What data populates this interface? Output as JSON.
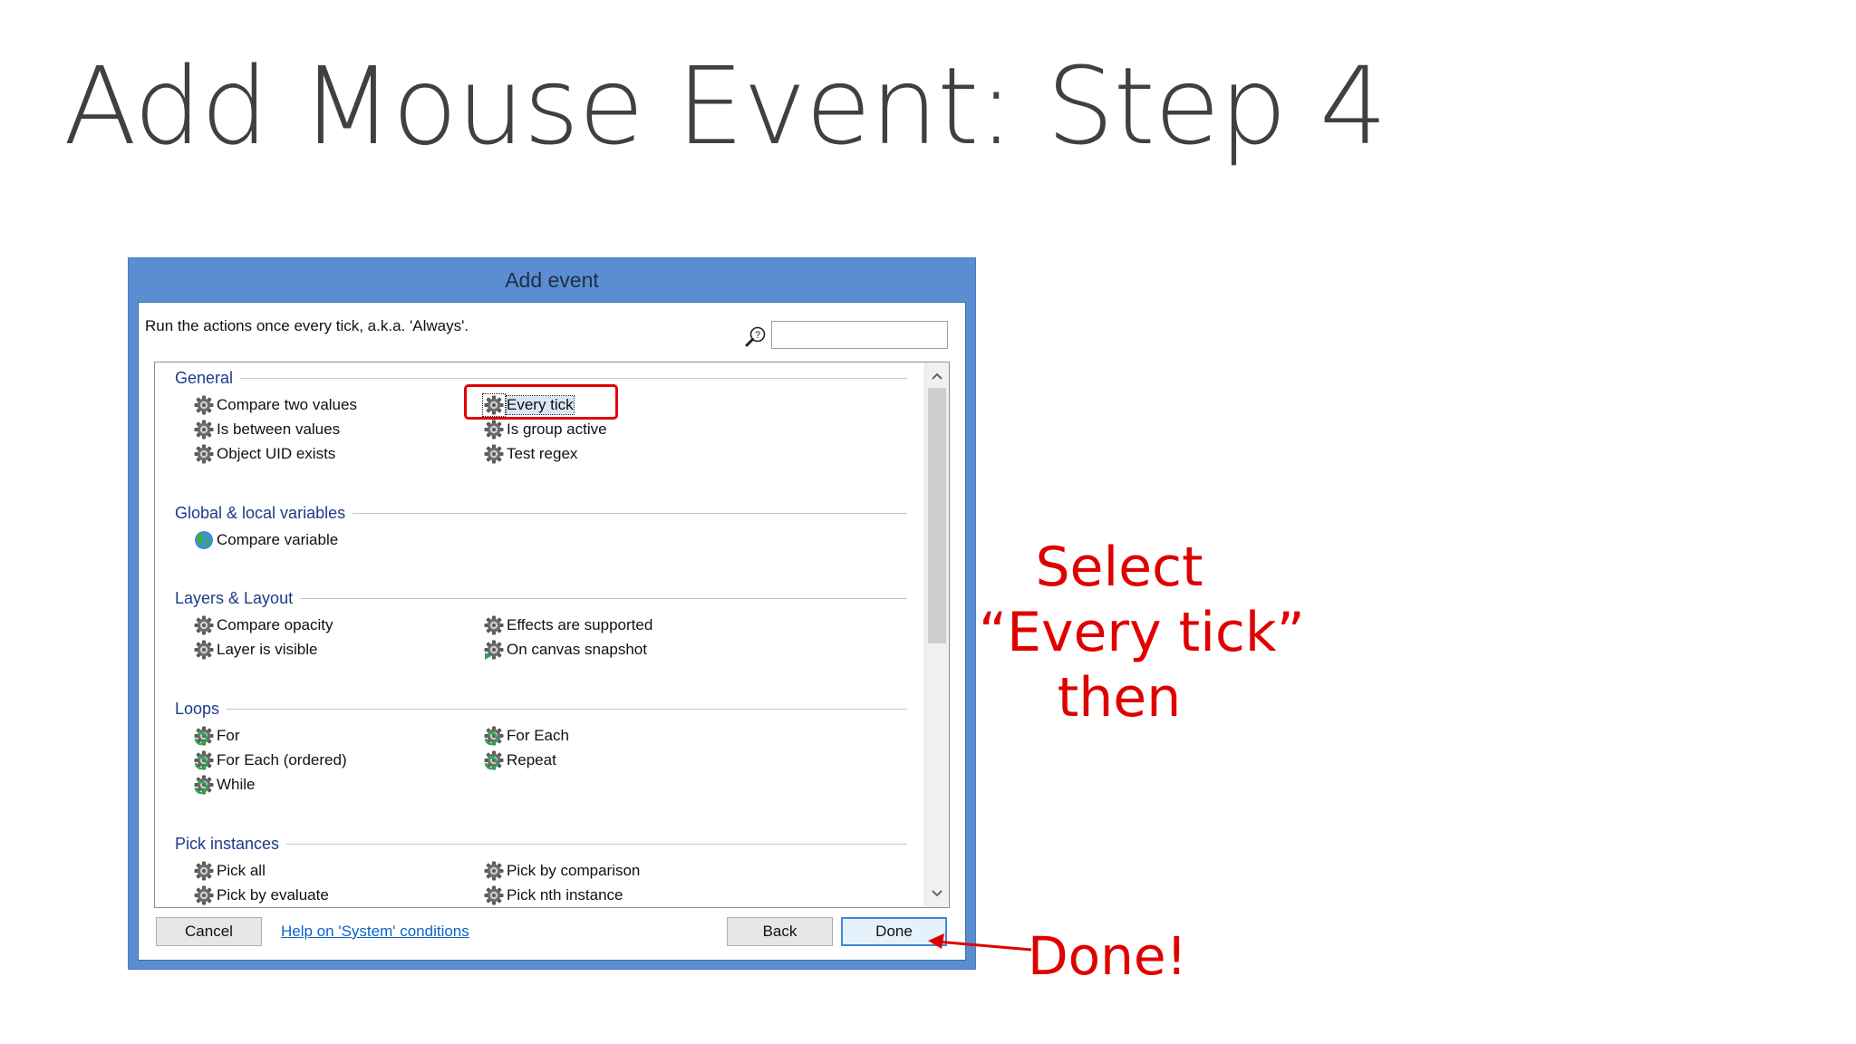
{
  "slide": {
    "title": "Add Mouse Event: Step 4"
  },
  "dialog": {
    "title": "Add event",
    "description": "Run the actions once every tick, a.k.a. 'Always'.",
    "search": {
      "value": "",
      "placeholder": ""
    },
    "groups": [
      {
        "label": "General",
        "items": [
          {
            "label": "Compare two values",
            "icon": "gear-icon"
          },
          {
            "label": "Is between values",
            "icon": "gear-icon"
          },
          {
            "label": "Object UID exists",
            "icon": "gear-icon"
          },
          {
            "label": "Every tick",
            "icon": "gear-icon",
            "selected": true
          },
          {
            "label": "Is group active",
            "icon": "gear-icon"
          },
          {
            "label": "Test regex",
            "icon": "gear-icon"
          }
        ]
      },
      {
        "label": "Global & local variables",
        "items": [
          {
            "label": "Compare variable",
            "icon": "globe-icon"
          }
        ]
      },
      {
        "label": "Layers & Layout",
        "items": [
          {
            "label": "Compare opacity",
            "icon": "gear-icon"
          },
          {
            "label": "Layer is visible",
            "icon": "gear-icon"
          },
          {
            "label": "Effects are supported",
            "icon": "gear-icon"
          },
          {
            "label": "On canvas snapshot",
            "icon": "gear-trigger-icon"
          }
        ]
      },
      {
        "label": "Loops",
        "items": [
          {
            "label": "For",
            "icon": "loop-gear-icon"
          },
          {
            "label": "For Each (ordered)",
            "icon": "loop-gear-icon"
          },
          {
            "label": "While",
            "icon": "loop-gear-icon"
          },
          {
            "label": "For Each",
            "icon": "loop-gear-icon"
          },
          {
            "label": "Repeat",
            "icon": "loop-gear-icon"
          }
        ]
      },
      {
        "label": "Pick instances",
        "items": [
          {
            "label": "Pick all",
            "icon": "gear-icon"
          },
          {
            "label": "Pick by evaluate",
            "icon": "gear-icon"
          },
          {
            "label": "Pick by comparison",
            "icon": "gear-icon"
          },
          {
            "label": "Pick nth instance",
            "icon": "gear-icon"
          }
        ]
      }
    ],
    "buttons": {
      "cancel": "Cancel",
      "help": "Help on 'System' conditions",
      "back": "Back",
      "done": "Done"
    }
  },
  "annotations": {
    "select_line1": "Select",
    "select_line2": "“Every tick”",
    "select_line3": "then",
    "done": "Done!",
    "color": "#e00000"
  },
  "colors": {
    "dialog_frame": "#5b8ed0",
    "group_label": "#1e3a8a",
    "link": "#0b64c8"
  }
}
